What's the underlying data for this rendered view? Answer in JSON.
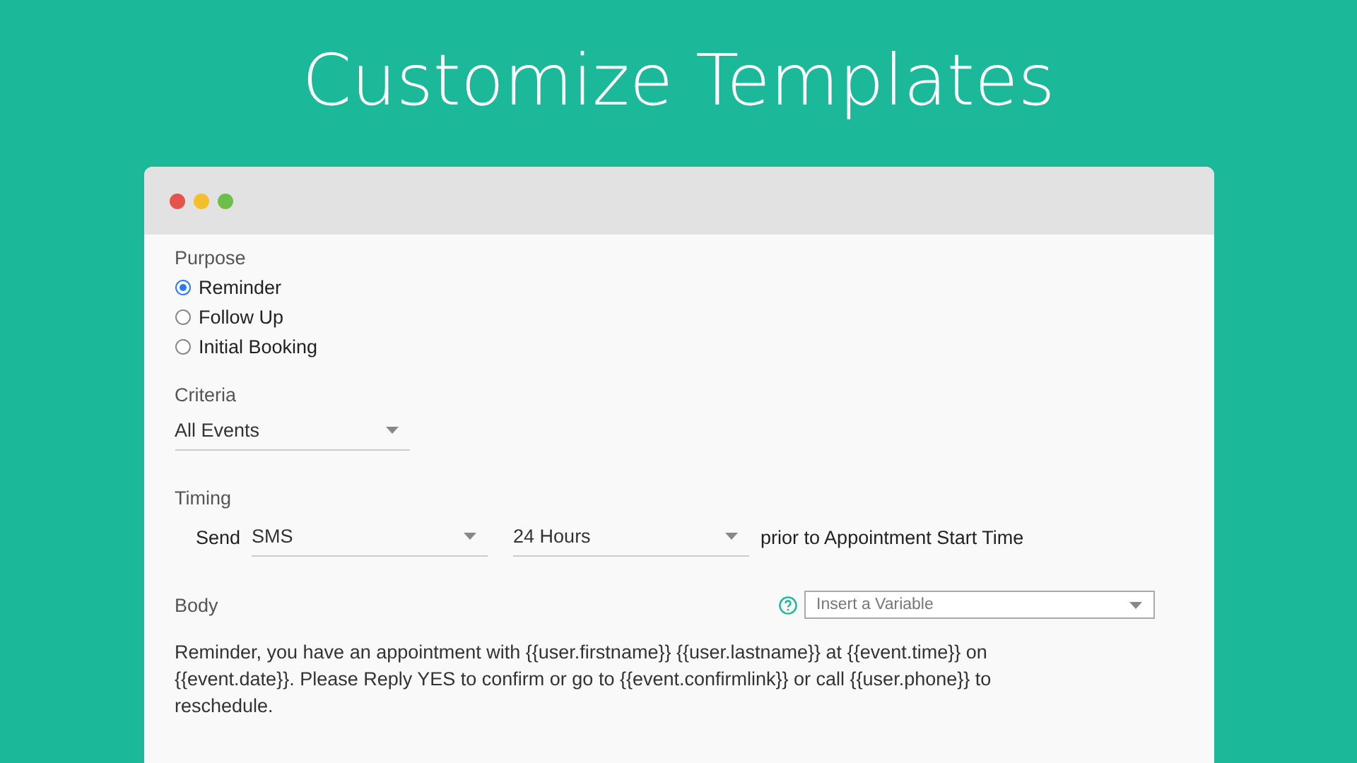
{
  "slide_title": "Customize Templates",
  "purpose": {
    "label": "Purpose",
    "options": [
      {
        "label": "Reminder",
        "selected": true
      },
      {
        "label": "Follow Up",
        "selected": false
      },
      {
        "label": "Initial Booking",
        "selected": false
      }
    ]
  },
  "criteria": {
    "label": "Criteria",
    "value": "All Events"
  },
  "timing": {
    "label": "Timing",
    "send_label": "Send",
    "channel": "SMS",
    "offset": "24 Hours",
    "suffix": "prior to Appointment Start Time"
  },
  "body": {
    "label": "Body",
    "variable_placeholder": "Insert a Variable",
    "text": "Reminder, you have an appointment with {{user.firstname}} {{user.lastname}} at {{event.time}} on {{event.date}}.  Please Reply YES to confirm or go to {{event.confirmlink}} or call {{user.phone}} to reschedule."
  }
}
